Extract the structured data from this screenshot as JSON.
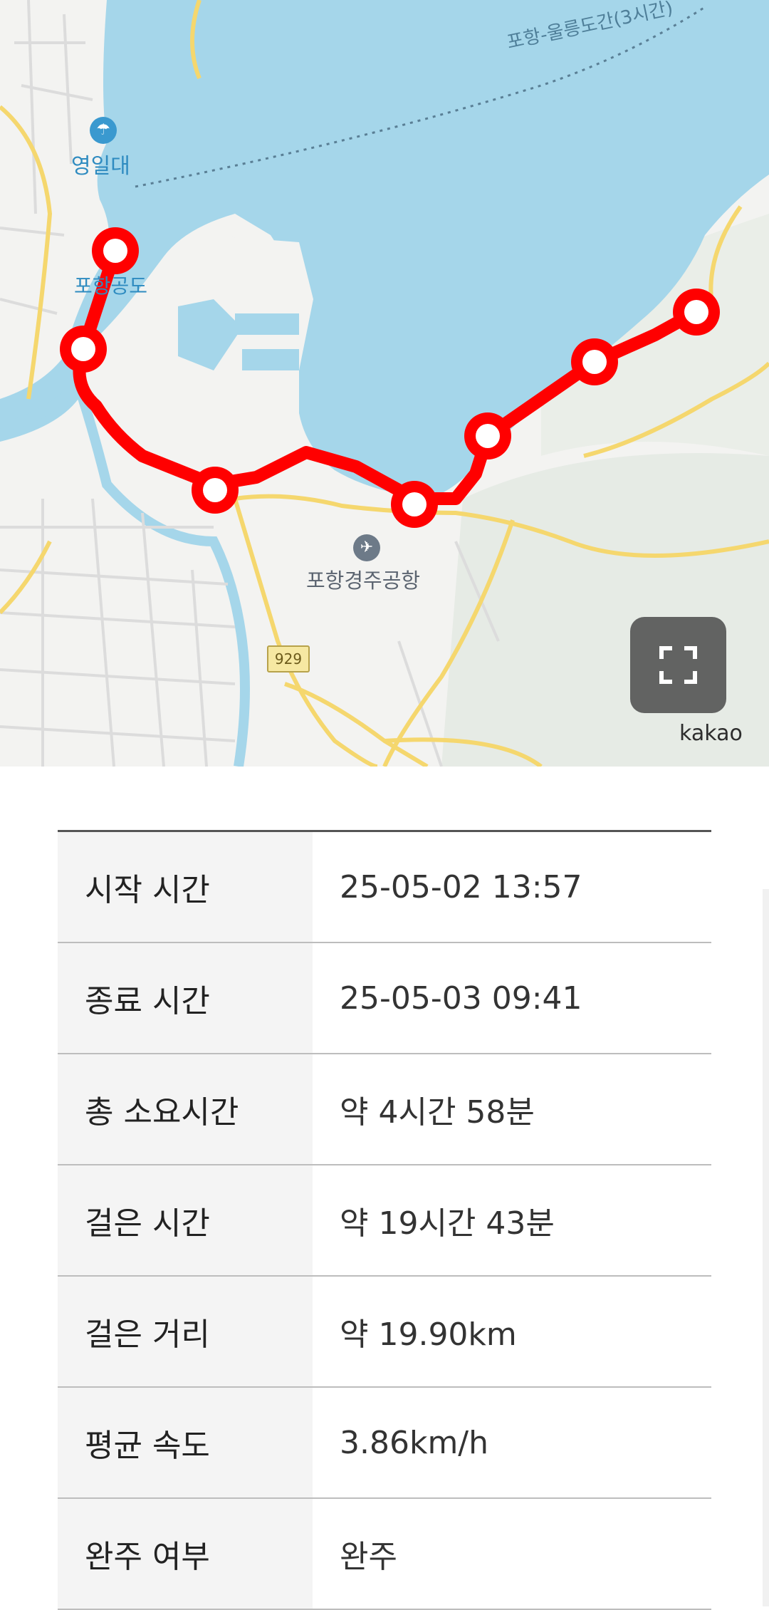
{
  "map": {
    "labels": {
      "sea_route": "포항-울릉도간(3시간)",
      "yeongildae": "영일대",
      "port": "포항공도",
      "airport": "포항경주공항",
      "route_number": "929",
      "provider": "kakao"
    },
    "icons": {
      "expand": "fullscreen-expand-icon",
      "yeongildae_pin": "beach-umbrella-icon",
      "airport_pin": "airplane-icon"
    },
    "colors": {
      "sea": "#a5d6ea",
      "route": "#ff0000",
      "road_major": "#f5d76e",
      "land": "#f3f3f1"
    }
  },
  "walk_info": {
    "rows": [
      {
        "label": "시작 시간",
        "value": "25-05-02 13:57"
      },
      {
        "label": "종료 시간",
        "value": "25-05-03 09:41"
      },
      {
        "label": "총 소요시간",
        "value": "약 4시간 58분"
      },
      {
        "label": "걸은 시간",
        "value": "약 19시간 43분"
      },
      {
        "label": "걸은 거리",
        "value": "약 19.90km"
      },
      {
        "label": "평균 속도",
        "value": "3.86km/h"
      },
      {
        "label": "완주 여부",
        "value": "완주"
      }
    ]
  }
}
